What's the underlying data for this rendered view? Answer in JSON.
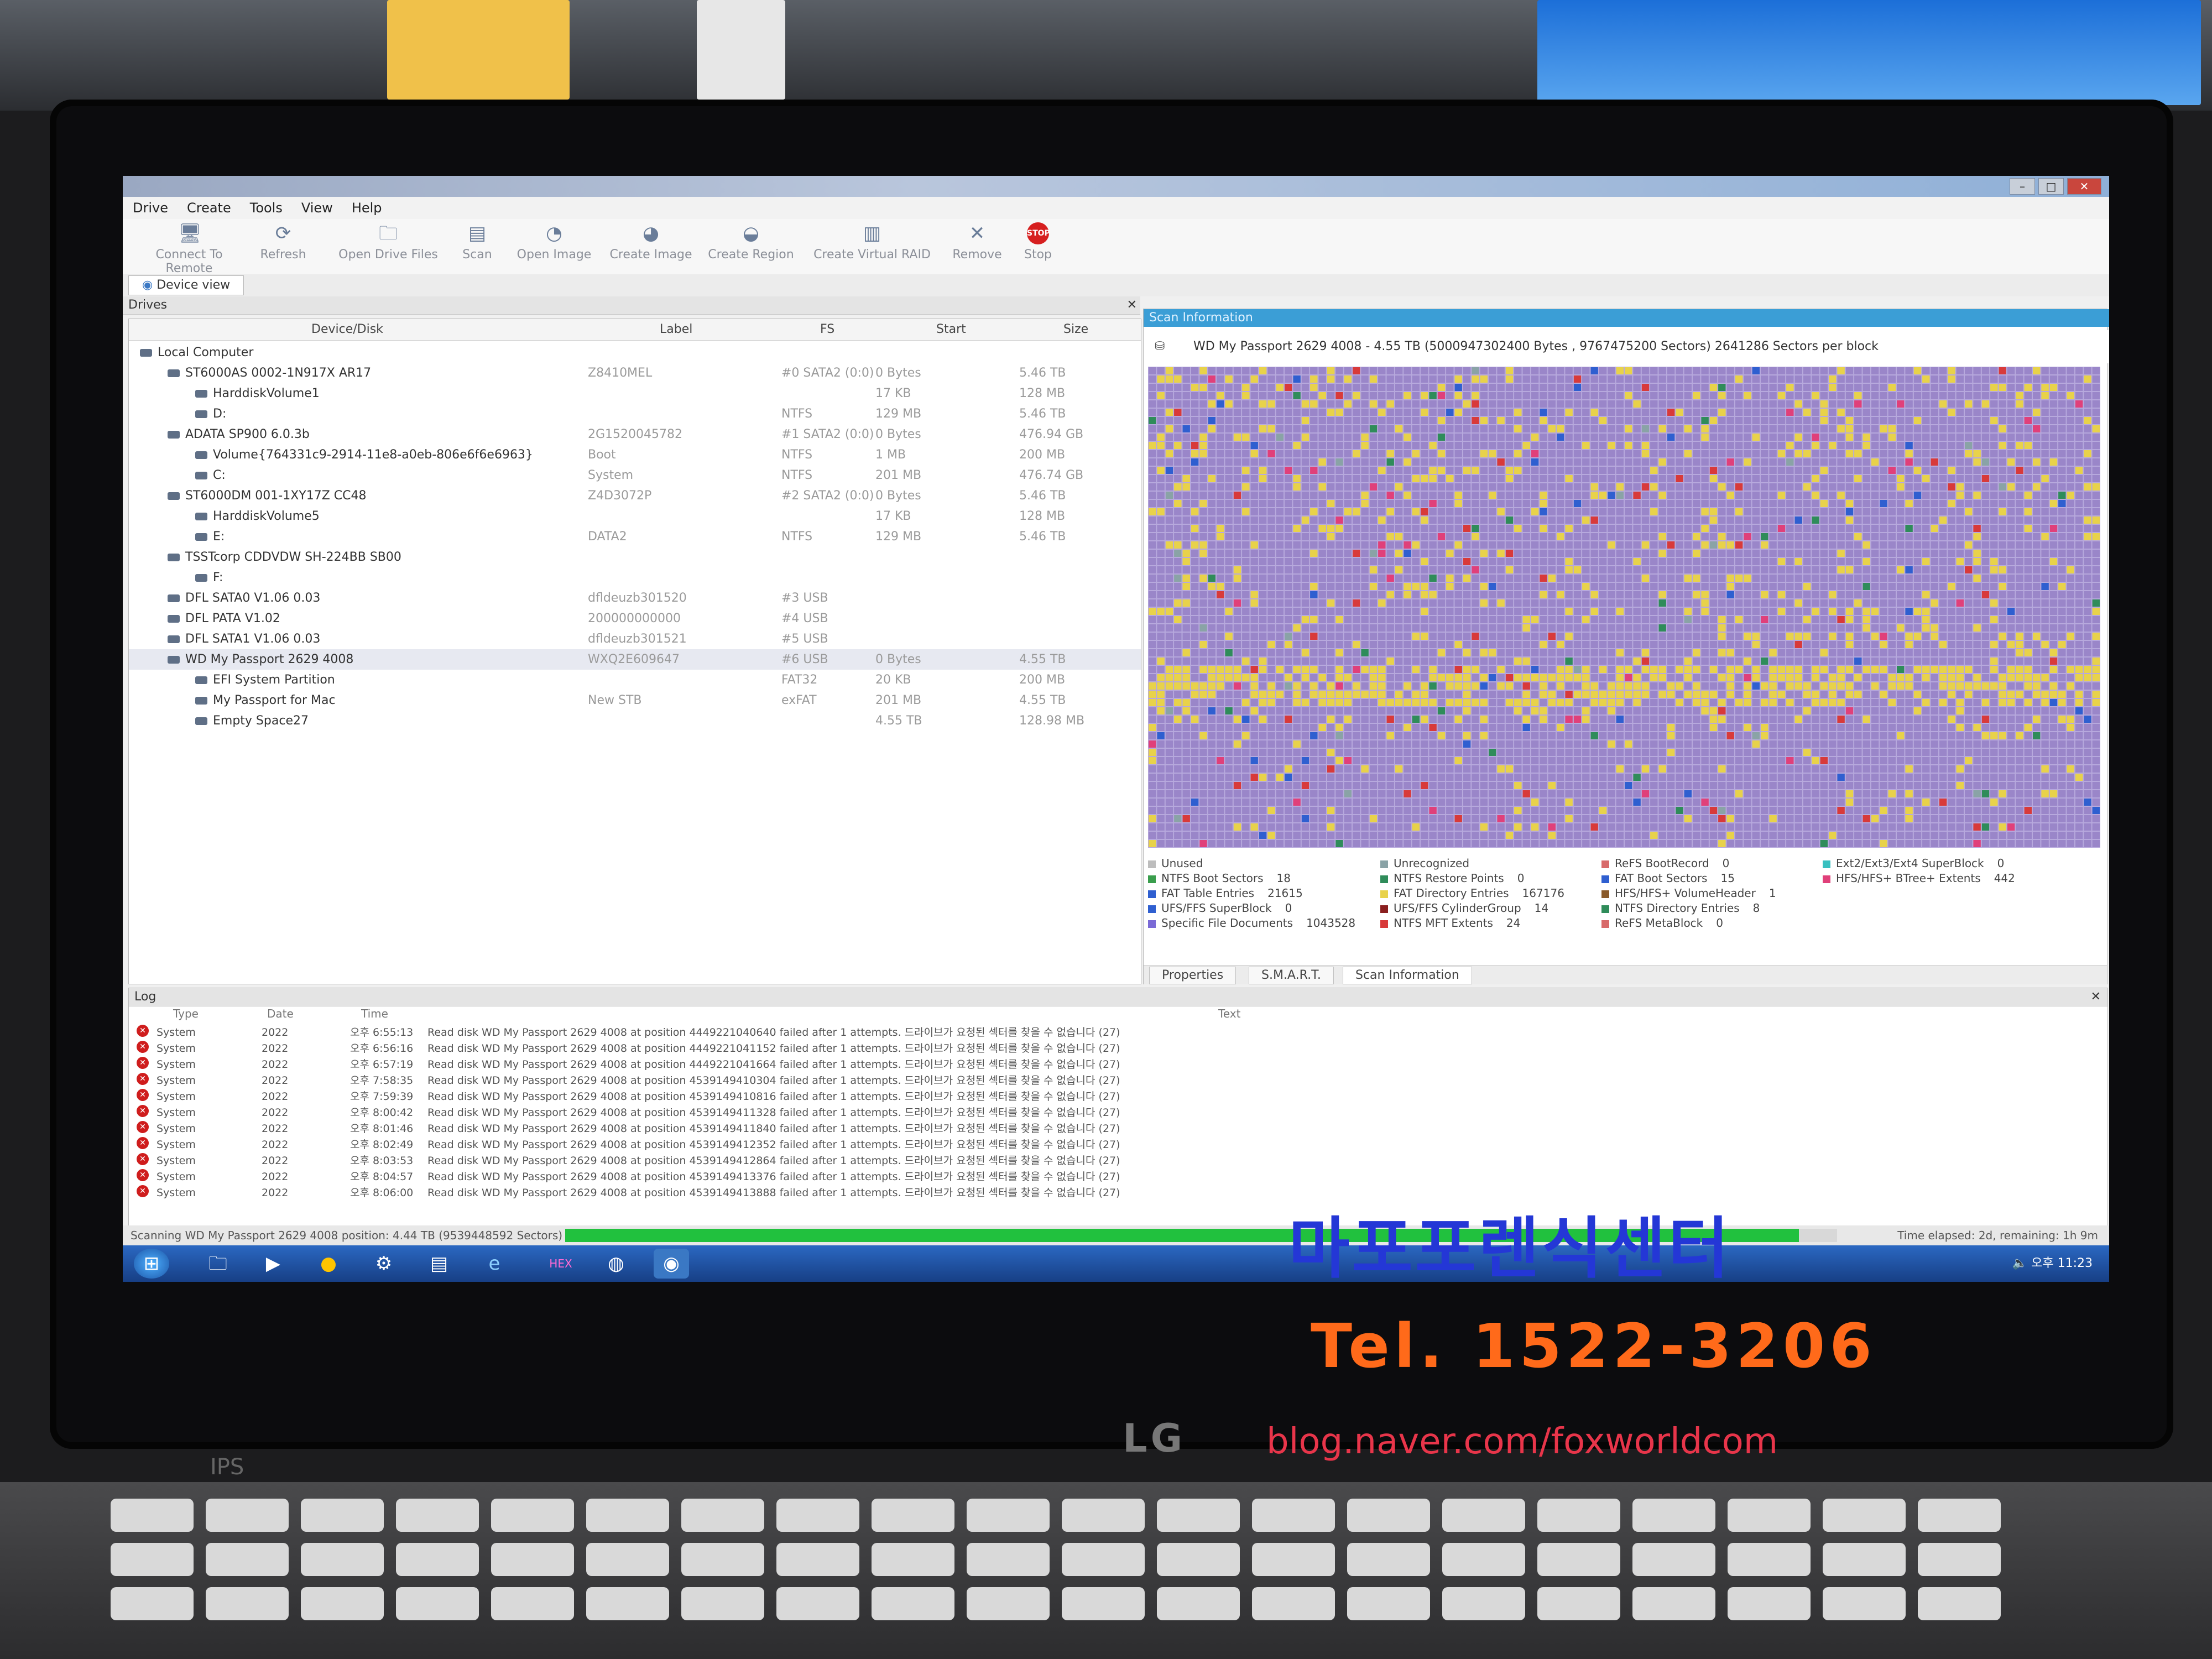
{
  "menu": [
    "Drive",
    "Create",
    "Tools",
    "View",
    "Help"
  ],
  "toolbar": [
    {
      "label": "Connect To Remote",
      "icon": "computer-icon"
    },
    {
      "label": "Refresh",
      "icon": "refresh-icon"
    },
    {
      "label": "Open Drive Files",
      "icon": "folder-icon"
    },
    {
      "label": "Scan",
      "icon": "scan-icon"
    },
    {
      "label": "Open Image",
      "icon": "open-image-icon"
    },
    {
      "label": "Create Image",
      "icon": "create-image-icon"
    },
    {
      "label": "Create Region",
      "icon": "region-icon"
    },
    {
      "label": "Create Virtual RAID",
      "icon": "raid-icon"
    },
    {
      "label": "Remove",
      "icon": "close-icon"
    },
    {
      "label": "Stop",
      "icon": "stop-icon"
    }
  ],
  "tabs": {
    "device_view": "Device view"
  },
  "drives": {
    "title": "Drives",
    "columns": [
      "Device/Disk",
      "Label",
      "FS",
      "Start",
      "Size"
    ],
    "rows": [
      {
        "name": "Local Computer",
        "label": "",
        "fs": "",
        "start": "",
        "size": "",
        "indent": 0
      },
      {
        "name": "ST6000AS 0002-1N917X AR17",
        "label": "Z8410MEL",
        "fs": "#0 SATA2 (0:0)",
        "start": "0 Bytes",
        "size": "5.46 TB",
        "indent": 1
      },
      {
        "name": "HarddiskVolume1",
        "label": "",
        "fs": "",
        "start": "17 KB",
        "size": "128 MB",
        "indent": 2
      },
      {
        "name": "D:",
        "label": "",
        "fs": "NTFS",
        "start": "129 MB",
        "size": "5.46 TB",
        "indent": 2
      },
      {
        "name": "ADATA SP900 6.0.3b",
        "label": "2G1520045782",
        "fs": "#1 SATA2 (0:0)",
        "start": "0 Bytes",
        "size": "476.94 GB",
        "indent": 1
      },
      {
        "name": "Volume{764331c9-2914-11e8-a0eb-806e6f6e6963}",
        "label": "Boot",
        "fs": "NTFS",
        "start": "1 MB",
        "size": "200 MB",
        "indent": 2
      },
      {
        "name": "C:",
        "label": "System",
        "fs": "NTFS",
        "start": "201 MB",
        "size": "476.74 GB",
        "indent": 2
      },
      {
        "name": "ST6000DM 001-1XY17Z CC48",
        "label": "Z4D3072P",
        "fs": "#2 SATA2 (0:0)",
        "start": "0 Bytes",
        "size": "5.46 TB",
        "indent": 1
      },
      {
        "name": "HarddiskVolume5",
        "label": "",
        "fs": "",
        "start": "17 KB",
        "size": "128 MB",
        "indent": 2
      },
      {
        "name": "E:",
        "label": "DATA2",
        "fs": "NTFS",
        "start": "129 MB",
        "size": "5.46 TB",
        "indent": 2
      },
      {
        "name": "TSSTcorp CDDVDW SH-224BB SB00",
        "label": "",
        "fs": "",
        "start": "",
        "size": "",
        "indent": 1
      },
      {
        "name": "F:",
        "label": "",
        "fs": "",
        "start": "",
        "size": "",
        "indent": 2
      },
      {
        "name": "DFL SATA0 V1.06 0.03",
        "label": "dfldeuzb301520",
        "fs": "#3 USB",
        "start": "",
        "size": "",
        "indent": 1
      },
      {
        "name": "DFL PATA V1.02",
        "label": "200000000000",
        "fs": "#4 USB",
        "start": "",
        "size": "",
        "indent": 1
      },
      {
        "name": "DFL SATA1 V1.06 0.03",
        "label": "dfldeuzb301521",
        "fs": "#5 USB",
        "start": "",
        "size": "",
        "indent": 1
      },
      {
        "name": "WD My Passport 2629 4008",
        "label": "WXQ2E609647",
        "fs": "#6 USB",
        "start": "0 Bytes",
        "size": "4.55 TB",
        "indent": 1,
        "selected": true
      },
      {
        "name": "EFI System Partition",
        "label": "",
        "fs": "FAT32",
        "start": "20 KB",
        "size": "200 MB",
        "indent": 2
      },
      {
        "name": "My Passport for Mac",
        "label": "New STB",
        "fs": "exFAT",
        "start": "201 MB",
        "size": "4.55 TB",
        "indent": 2
      },
      {
        "name": "Empty Space27",
        "label": "",
        "fs": "",
        "start": "4.55 TB",
        "size": "128.98 MB",
        "indent": 2
      }
    ]
  },
  "scan": {
    "title": "Scan Information",
    "info": "WD My Passport 2629 4008 - 4.55 TB (5000947302400 Bytes , 9767475200 Sectors) 2641286 Sectors per block",
    "colors": {
      "unused": "#9a86c9",
      "fat_dir": "#e8d24a",
      "ntfs_mft": "#d83a3a",
      "ufs": "#2f5fd0",
      "ntfs_restore": "#2f8c5a",
      "hfs_btree": "#e0407a",
      "ntfs_boot": "#3a9e4d",
      "ext": "#39c0c0",
      "unrecognized": "#8aa3a6"
    },
    "legend": [
      {
        "label": "Unused",
        "value": "",
        "color": "#bdbdbd"
      },
      {
        "label": "NTFS Boot Sectors",
        "value": "18",
        "color": "#3a9e4d"
      },
      {
        "label": "FAT Table Entries",
        "value": "21615",
        "color": "#2f5fd0"
      },
      {
        "label": "UFS/FFS SuperBlock",
        "value": "0",
        "color": "#2f5fd0"
      },
      {
        "label": "Specific File Documents",
        "value": "1043528",
        "color": "#7a6ad6"
      },
      {
        "label": "Unrecognized",
        "value": "",
        "color": "#8aa3a6"
      },
      {
        "label": "NTFS Restore Points",
        "value": "0",
        "color": "#2f8c5a"
      },
      {
        "label": "FAT Directory Entries",
        "value": "167176",
        "color": "#e8d24a"
      },
      {
        "label": "UFS/FFS CylinderGroup",
        "value": "14",
        "color": "#8a1f1f"
      },
      {
        "label": "NTFS MFT Extents",
        "value": "24",
        "color": "#d83a3a"
      },
      {
        "label": "ReFS BootRecord",
        "value": "0",
        "color": "#d86a6a"
      },
      {
        "label": "FAT Boot Sectors",
        "value": "15",
        "color": "#2f5fd0"
      },
      {
        "label": "HFS/HFS+ VolumeHeader",
        "value": "1",
        "color": "#8a5a2a"
      },
      {
        "label": "NTFS Directory Entries",
        "value": "8",
        "color": "#2f8c5a"
      },
      {
        "label": "ReFS MetaBlock",
        "value": "0",
        "color": "#d86a6a"
      },
      {
        "label": "Ext2/Ext3/Ext4 SuperBlock",
        "value": "0",
        "color": "#39c0c0"
      },
      {
        "label": "HFS/HFS+ BTree+ Extents",
        "value": "442",
        "color": "#e0407a"
      }
    ],
    "tabs": [
      "Properties",
      "S.M.A.R.T.",
      "Scan Information"
    ]
  },
  "log": {
    "title": "Log",
    "columns": [
      "Type",
      "Date",
      "Time",
      "Text"
    ],
    "rows": [
      {
        "type": "System",
        "date": "2022",
        "time": "오후 6:55:13",
        "text": "Read disk WD My Passport 2629 4008 at position 4449221040640 failed after 1 attempts. 드라이브가 요청된 섹터를 찾을 수 없습니다 (27)"
      },
      {
        "type": "System",
        "date": "2022",
        "time": "오후 6:56:16",
        "text": "Read disk WD My Passport 2629 4008 at position 4449221041152 failed after 1 attempts. 드라이브가 요청된 섹터를 찾을 수 없습니다 (27)"
      },
      {
        "type": "System",
        "date": "2022",
        "time": "오후 6:57:19",
        "text": "Read disk WD My Passport 2629 4008 at position 4449221041664 failed after 1 attempts. 드라이브가 요청된 섹터를 찾을 수 없습니다 (27)"
      },
      {
        "type": "System",
        "date": "2022",
        "time": "오후 7:58:35",
        "text": "Read disk WD My Passport 2629 4008 at position 4539149410304 failed after 1 attempts. 드라이브가 요청된 섹터를 찾을 수 없습니다 (27)"
      },
      {
        "type": "System",
        "date": "2022",
        "time": "오후 7:59:39",
        "text": "Read disk WD My Passport 2629 4008 at position 4539149410816 failed after 1 attempts. 드라이브가 요청된 섹터를 찾을 수 없습니다 (27)"
      },
      {
        "type": "System",
        "date": "2022",
        "time": "오후 8:00:42",
        "text": "Read disk WD My Passport 2629 4008 at position 4539149411328 failed after 1 attempts. 드라이브가 요청된 섹터를 찾을 수 없습니다 (27)"
      },
      {
        "type": "System",
        "date": "2022",
        "time": "오후 8:01:46",
        "text": "Read disk WD My Passport 2629 4008 at position 4539149411840 failed after 1 attempts. 드라이브가 요청된 섹터를 찾을 수 없습니다 (27)"
      },
      {
        "type": "System",
        "date": "2022",
        "time": "오후 8:02:49",
        "text": "Read disk WD My Passport 2629 4008 at position 4539149412352 failed after 1 attempts. 드라이브가 요청된 섹터를 찾을 수 없습니다 (27)"
      },
      {
        "type": "System",
        "date": "2022",
        "time": "오후 8:03:53",
        "text": "Read disk WD My Passport 2629 4008 at position 4539149412864 failed after 1 attempts. 드라이브가 요청된 섹터를 찾을 수 없습니다 (27)"
      },
      {
        "type": "System",
        "date": "2022",
        "time": "오후 8:04:57",
        "text": "Read disk WD My Passport 2629 4008 at position 4539149413376 failed after 1 attempts. 드라이브가 요청된 섹터를 찾을 수 없습니다 (27)"
      },
      {
        "type": "System",
        "date": "2022",
        "time": "오후 8:06:00",
        "text": "Read disk WD My Passport 2629 4008 at position 4539149413888 failed after 1 attempts. 드라이브가 요청된 섹터를 찾을 수 없습니다 (27)"
      }
    ]
  },
  "status": {
    "text": "Scanning WD My Passport 2629 4008 position: 4.44 TB (9539448592 Sectors)",
    "progress": 0.97,
    "elapsed": "Time elapsed: 2d, remaining: 1h 9m"
  },
  "taskbar": {
    "clock": "오후 11:23",
    "accent": "#1e56b5"
  },
  "watermark": {
    "name": "마포포렌식센터",
    "phone": "Tel. 1522-3206",
    "blog": "blog.naver.com/foxworldcom"
  },
  "bezel": {
    "brand": "LG",
    "panel": "IPS"
  }
}
